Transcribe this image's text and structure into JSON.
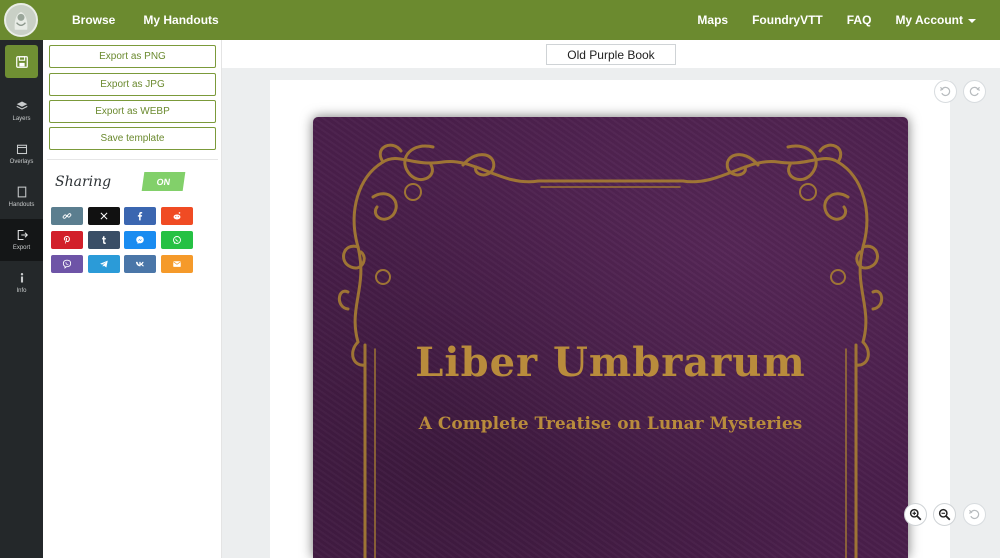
{
  "nav": {
    "left": [
      "Browse",
      "My Handouts"
    ],
    "right": [
      "Maps",
      "FoundryVTT",
      "FAQ"
    ],
    "account": "My Account"
  },
  "rail": {
    "items": [
      {
        "label": "Layers",
        "icon": "layers-icon"
      },
      {
        "label": "Overlays",
        "icon": "overlays-icon"
      },
      {
        "label": "Handouts",
        "icon": "handouts-icon"
      },
      {
        "label": "Export",
        "icon": "export-icon",
        "active": true
      },
      {
        "label": "Info",
        "icon": "info-icon"
      }
    ]
  },
  "panel": {
    "export_png": "Export as PNG",
    "export_jpg": "Export as JPG",
    "export_webp": "Export as WEBP",
    "save_template": "Save template",
    "sharing_label": "Sharing",
    "sharing_toggle": "ON",
    "share_buttons": [
      {
        "name": "copy-link",
        "color": "#5b7e8f"
      },
      {
        "name": "x",
        "color": "#111111"
      },
      {
        "name": "facebook",
        "color": "#3b66b0"
      },
      {
        "name": "reddit",
        "color": "#f04b23"
      },
      {
        "name": "pinterest",
        "color": "#d21f2a"
      },
      {
        "name": "tumblr",
        "color": "#3a4e66"
      },
      {
        "name": "messenger",
        "color": "#1a8cf0"
      },
      {
        "name": "whatsapp",
        "color": "#25c144"
      },
      {
        "name": "viber",
        "color": "#6e54a7"
      },
      {
        "name": "telegram",
        "color": "#2b9bd8"
      },
      {
        "name": "vk",
        "color": "#4a76a8"
      },
      {
        "name": "email",
        "color": "#f59a2a"
      }
    ]
  },
  "canvas": {
    "handout_name": "Old Purple Book",
    "book_title": "Liber Umbrarum",
    "book_subtitle": "A Complete Treatise on Lunar Mysteries"
  },
  "colors": {
    "accent": "#6b8a2f",
    "book_cover": "#4a1f4b",
    "gold": "#b98c3c"
  }
}
